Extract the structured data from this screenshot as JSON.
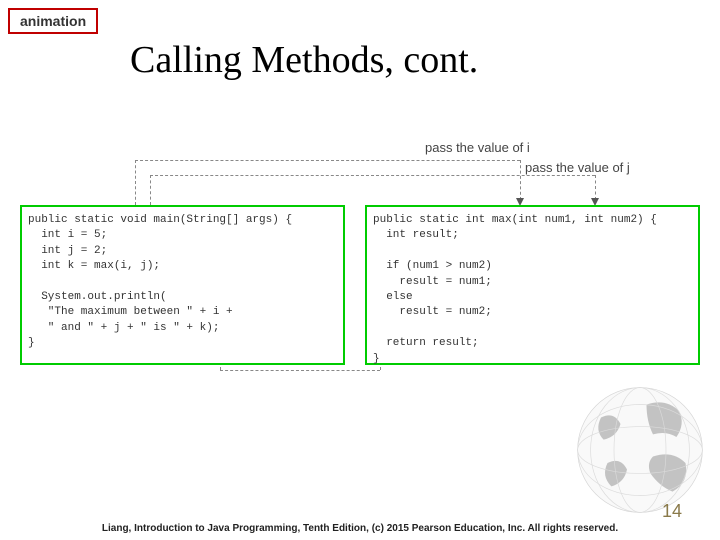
{
  "tag": "animation",
  "title": "Calling Methods, cont.",
  "labels": {
    "pass_i": "pass the value of i",
    "pass_j": "pass the value of j"
  },
  "code": {
    "main": "public static void main(String[] args) {\n  int i = 5;\n  int j = 2;\n  int k = max(i, j);\n\n  System.out.println(\n   \"The maximum between \" + i +\n   \" and \" + j + \" is \" + k);\n}",
    "max": "public static int max(int num1, int num2) {\n  int result;\n\n  if (num1 > num2)\n    result = num1;\n  else\n    result = num2;\n\n  return result;\n}"
  },
  "footer": "Liang, Introduction to Java Programming, Tenth Edition, (c) 2015 Pearson Education, Inc. All rights reserved.",
  "page": "14"
}
